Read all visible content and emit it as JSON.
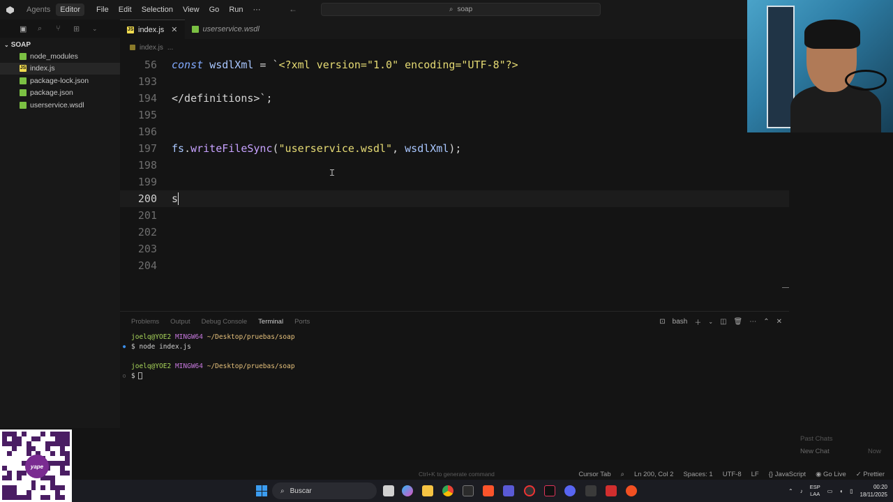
{
  "titlebar": {
    "modes": [
      "Agents",
      "Editor"
    ],
    "menu": [
      "File",
      "Edit",
      "Selection",
      "View",
      "Go",
      "Run",
      "···"
    ],
    "search": "soap"
  },
  "sidebar": {
    "title": "SOAP",
    "items": [
      {
        "label": "node_modules",
        "icon": "folder-icon",
        "color": "#7bc043"
      },
      {
        "label": "index.js",
        "icon": "js-file-icon",
        "color": "#f0db4f"
      },
      {
        "label": "package-lock.json",
        "icon": "json-file-icon",
        "color": "#7bc043"
      },
      {
        "label": "package.json",
        "icon": "json-file-icon",
        "color": "#7bc043"
      },
      {
        "label": "userservice.wsdl",
        "icon": "wsdl-file-icon",
        "color": "#7bc043"
      }
    ]
  },
  "tabs": [
    {
      "label": "index.js",
      "close": "✕"
    },
    {
      "label": "userservice.wsdl"
    }
  ],
  "breadcrumb": {
    "file": "index.js",
    "more": "..."
  },
  "editor": {
    "lines": [
      {
        "num": "56",
        "tokens": [
          [
            "kw",
            "const"
          ],
          [
            "plain",
            " "
          ],
          [
            "id",
            "wsdlXml"
          ],
          [
            "plain",
            " = `"
          ],
          [
            "str",
            "<?xml version=\"1.0\" encoding=\"UTF-8\"?>"
          ]
        ]
      },
      {
        "num": "193",
        "tokens": []
      },
      {
        "num": "194",
        "tokens": [
          [
            "plain",
            "</definitions>`;"
          ]
        ]
      },
      {
        "num": "195",
        "tokens": []
      },
      {
        "num": "196",
        "tokens": []
      },
      {
        "num": "197",
        "tokens": [
          [
            "id",
            "fs"
          ],
          [
            "plain",
            "."
          ],
          [
            "fn",
            "writeFileSync"
          ],
          [
            "plain",
            "("
          ],
          [
            "str",
            "\"userservice.wsdl\""
          ],
          [
            "plain",
            ", "
          ],
          [
            "id",
            "wsdlXml"
          ],
          [
            "plain",
            ");"
          ]
        ]
      },
      {
        "num": "198",
        "tokens": []
      },
      {
        "num": "199",
        "tokens": []
      },
      {
        "num": "200",
        "tokens": [
          [
            "plain",
            "s"
          ]
        ],
        "current": true
      },
      {
        "num": "201",
        "tokens": []
      },
      {
        "num": "202",
        "tokens": []
      },
      {
        "num": "203",
        "tokens": []
      },
      {
        "num": "204",
        "tokens": []
      }
    ]
  },
  "panel": {
    "tabs": [
      "Problems",
      "Output",
      "Debug Console",
      "Terminal",
      "Ports"
    ],
    "active_tab": "Terminal",
    "shell": "bash",
    "terminal": [
      {
        "user": "joelq@YOE2",
        "host": "MINGW64",
        "path": "~/Desktop/pruebas/soap"
      },
      {
        "prompt": "$",
        "cmd": "node index.js"
      },
      {
        "blank": true
      },
      {
        "user": "joelq@YOE2",
        "host": "MINGW64",
        "path": "~/Desktop/pruebas/soap"
      },
      {
        "prompt": "$",
        "cmd": ""
      }
    ]
  },
  "chat": {
    "past": "Past Chats",
    "new": "New Chat",
    "now": "Now"
  },
  "statusbar": {
    "hint": "Ctrl+K to generate command",
    "cursor_tab": "Cursor Tab",
    "position": "Ln 200, Col 2",
    "spaces": "Spaces: 1",
    "encoding": "UTF-8",
    "eol": "LF",
    "language": "JavaScript",
    "golive": "Go Live",
    "prettier": "Prettier"
  },
  "qr": {
    "brand": "yape"
  },
  "taskbar": {
    "search": "Buscar",
    "lang_top": "ESP",
    "lang_bottom": "LAA",
    "time": "00:20",
    "date": "18/11/2025"
  }
}
